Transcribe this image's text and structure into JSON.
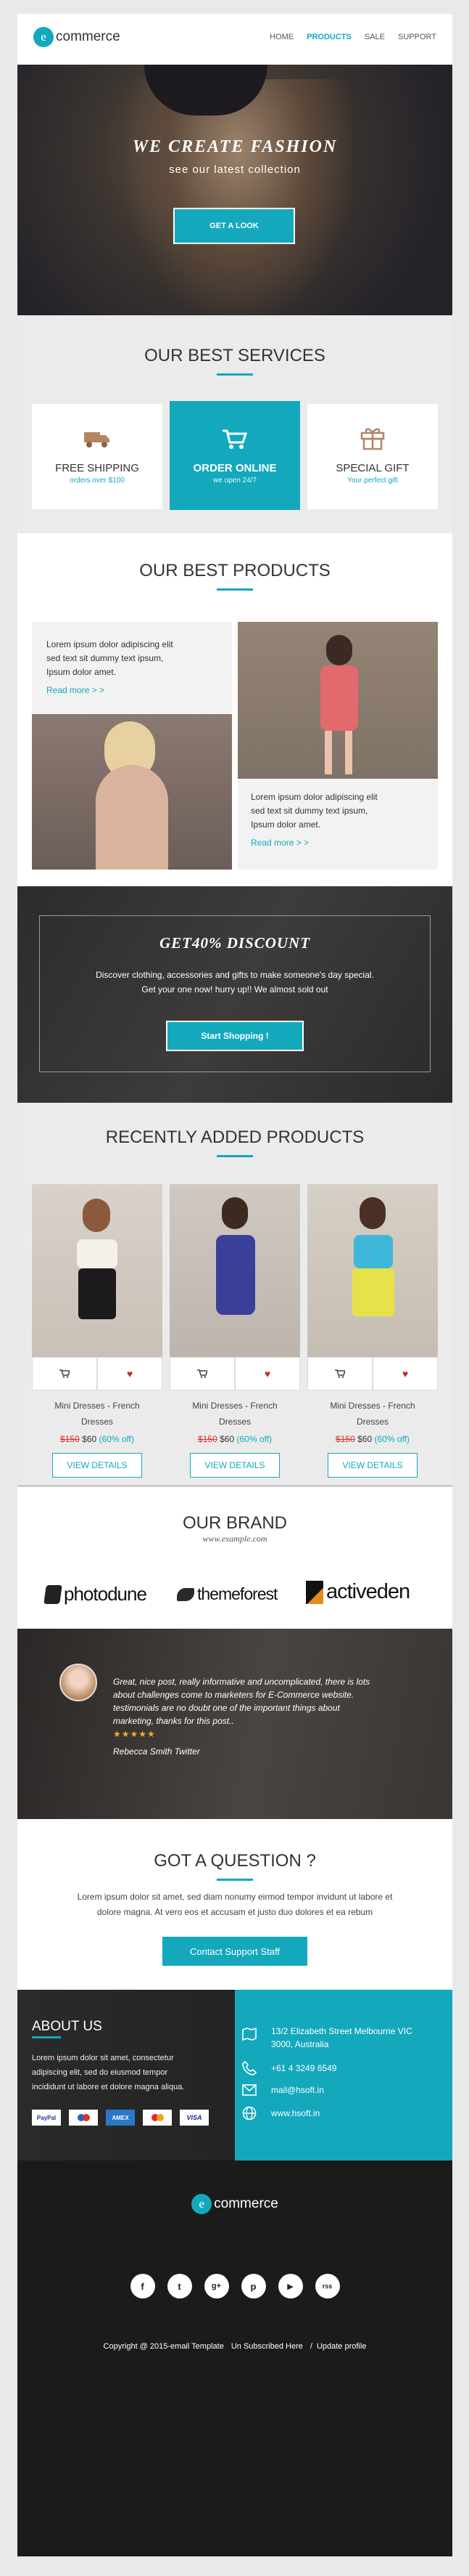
{
  "header": {
    "logo_badge": "e",
    "logo_text": "commerce",
    "nav": [
      "HOME",
      "PRODUCTS",
      "SALE",
      "SUPPORT"
    ]
  },
  "hero": {
    "title": "WE CREATE FASHION",
    "subtitle": "see our latest collection",
    "cta": "GET A LOOK"
  },
  "services": {
    "title": "OUR BEST SERVICES",
    "items": [
      {
        "title": "FREE SHIPPING",
        "sub": "orders over $100",
        "icon": "truck-icon"
      },
      {
        "title": "ORDER ONLINE",
        "sub": "we open 24/7",
        "icon": "cart-icon"
      },
      {
        "title": "SPECIAL GIFT",
        "sub": "Your perfect gift",
        "icon": "gift-icon"
      }
    ]
  },
  "products": {
    "title": "OUR BEST PRODUCTS",
    "blurb1": [
      "Lorem ipsum dolor adipiscing elit",
      "sed text sit dummy text ipsum,",
      "Ipsum dolor amet."
    ],
    "blurb2": [
      "Lorem ipsum dolor adipiscing elit",
      "sed text sit dummy text ipsum,",
      "Ipsum dolor amet."
    ],
    "read_more": "Read more > >"
  },
  "discount": {
    "title": "GET40% DISCOUNT",
    "line1": "Discover clothing, accessories and gifts to make someone's day special.",
    "line2": "Get your one now! hurry up!! We almost sold out",
    "cta": "Start Shopping !"
  },
  "recent": {
    "title": "RECENTLY ADDED PRODUCTS",
    "items": [
      {
        "name1": "Mini Dresses - French",
        "name2": "Dresses",
        "old": "$150",
        "new": "$60",
        "off": "(60% off)",
        "cta": "VIEW DETAILS"
      },
      {
        "name1": "Mini Dresses - French",
        "name2": "Dresses",
        "old": "$150",
        "new": "$60",
        "off": "(60% off)",
        "cta": "VIEW DETAILS"
      },
      {
        "name1": "Mini Dresses - French",
        "name2": "Dresses",
        "old": "$150",
        "new": "$60",
        "off": "(60% off)",
        "cta": "VIEW DETAILS"
      }
    ]
  },
  "brand": {
    "title": "OUR BRAND",
    "sub": "www.example.com",
    "logos": [
      "photodune",
      "themeforest",
      "activeden"
    ]
  },
  "testimonial": {
    "text": [
      "Great, nice post, really informative and uncomplicated, there is lots",
      "about challenges come to marketers for E-Commerce website.",
      "testimonials are no doubt one of the important things about",
      "marketing, thanks for this post.."
    ],
    "stars": "★★★★★",
    "author": "Rebecca Smith Twitter"
  },
  "question": {
    "title": "GOT A QUESTION ?",
    "line1": "Lorem ipsum dolor sit amet, sed diam nonumy eirmod tempor invidunt ut labore et",
    "line2": "dolore magna. At vero eos et accusam et justo duo dolores et ea rebum",
    "cta": "Contact Support Staff"
  },
  "about": {
    "title": "ABOUT US",
    "text": [
      "Lorem ipsum dolor sit amet, consectetur",
      "adipiscing elit, sed do eiusmod tempor",
      "incididunt ut labore et dolore magna aliqua."
    ],
    "cards": [
      "PayPal",
      "Maestro",
      "AMEX",
      "MC",
      "VISA"
    ]
  },
  "contact": {
    "address1": "13/2 Elizabeth Street Melbourne VIC",
    "address2": "3000, Australia",
    "phone": "+61 4 3249 6549",
    "email": "mail@hsoft.in",
    "web": "www.hsoft.in"
  },
  "footer": {
    "logo_badge": "e",
    "logo_text": "commerce",
    "social": [
      "f",
      "t",
      "g+",
      "p",
      "▶",
      "rss"
    ],
    "copyright": "Copyright @ 2015-email Template",
    "unsubscribe": "Un Subscribed Here",
    "sep": "/",
    "update": "Update profile"
  },
  "colors": {
    "accent": "#14a8bd",
    "dark": "#1b1b1b",
    "price_old": "#d9312b"
  }
}
